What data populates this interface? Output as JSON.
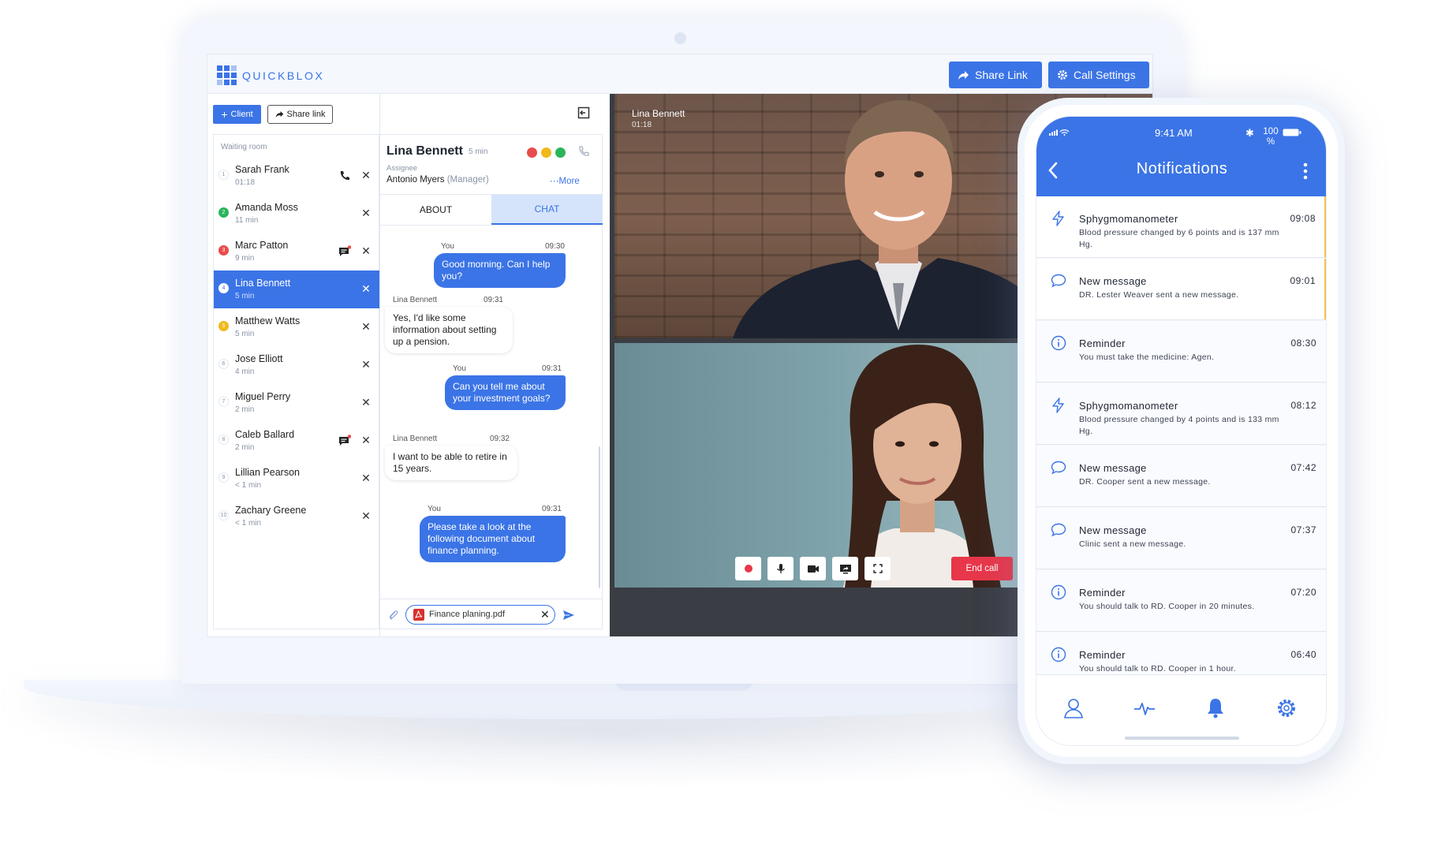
{
  "brand": {
    "name": "QUICKBLOX",
    "accent": "#3b74e6"
  },
  "topbar": {
    "share_link": "Share Link",
    "call_settings": "Call Settings"
  },
  "left": {
    "client_button": "Client",
    "share_link_button": "Share link",
    "waiting_title": "Waiting room",
    "items": [
      {
        "num": "1",
        "name": "Sarah Frank",
        "time": "01:18"
      },
      {
        "num": "2",
        "name": "Amanda Moss",
        "time": "11 min"
      },
      {
        "num": "3",
        "name": "Marc Patton",
        "time": "9 min"
      },
      {
        "num": "4",
        "name": "Lina Bennett",
        "time": "5 min"
      },
      {
        "num": "5",
        "name": "Matthew Watts",
        "time": "5 min"
      },
      {
        "num": "6",
        "name": "Jose Elliott",
        "time": "4 min"
      },
      {
        "num": "7",
        "name": "Miguel Perry",
        "time": "2 min"
      },
      {
        "num": "8",
        "name": "Caleb Ballard",
        "time": "2 min"
      },
      {
        "num": "9",
        "name": "Lillian Pearson",
        "time": "< 1 min"
      },
      {
        "num": "10",
        "name": "Zachary Greene",
        "time": "< 1 min"
      }
    ]
  },
  "chat": {
    "name": "Lina Bennett",
    "duration": "5 min",
    "assignee_label": "Assignee",
    "assignee": "Antonio Myers",
    "assignee_role": "(Manager)",
    "more": "More",
    "tabs": {
      "about": "ABOUT",
      "chat": "CHAT"
    },
    "messages": [
      {
        "sender": "You",
        "time": "09:30",
        "text": "Good morning. Can I help you?"
      },
      {
        "sender": "Lina Bennett",
        "time": "09:31",
        "text": "Yes, I'd like some information about setting up a pension."
      },
      {
        "sender": "You",
        "time": "09:31",
        "text": "Can you tell me about your investment goals?"
      },
      {
        "sender": "Lina Bennett",
        "time": "09:32",
        "text": "I want to be able to retire in 15 years."
      },
      {
        "sender": "You",
        "time": "09:31",
        "text": "Please take a look at the following document about finance planning."
      }
    ],
    "attachment": "Finance planing.pdf"
  },
  "video": {
    "caller_name": "Lina Bennett",
    "call_time": "01:18",
    "end_call": "End call"
  },
  "phone": {
    "time": "9:41 AM",
    "battery": "100 %",
    "title": "Notifications",
    "notifications": [
      {
        "icon": "bolt-icon",
        "title": "Sphygmomanometer",
        "time": "09:08",
        "body": "Blood pressure changed by 6 points and is 137 mm Hg."
      },
      {
        "icon": "chat-bubble-icon",
        "title": "New message",
        "time": "09:01",
        "body": "DR. Lester Weaver sent a new message."
      },
      {
        "icon": "info-icon",
        "title": "Reminder",
        "time": "08:30",
        "body": "You must take the medicine: Agen."
      },
      {
        "icon": "bolt-icon",
        "title": "Sphygmomanometer",
        "time": "08:12",
        "body": "Blood pressure changed by 4 points and is 133 mm Hg."
      },
      {
        "icon": "chat-bubble-icon",
        "title": "New message",
        "time": "07:42",
        "body": "DR. Cooper sent a new message."
      },
      {
        "icon": "chat-bubble-icon",
        "title": "New message",
        "time": "07:37",
        "body": "Clinic sent a new message."
      },
      {
        "icon": "info-icon",
        "title": "Reminder",
        "time": "07:20",
        "body": "You should talk to RD. Cooper  in 20 minutes."
      },
      {
        "icon": "info-icon",
        "title": "Reminder",
        "time": "06:40",
        "body": "You should talk to RD. Cooper  in 1 hour."
      }
    ]
  }
}
